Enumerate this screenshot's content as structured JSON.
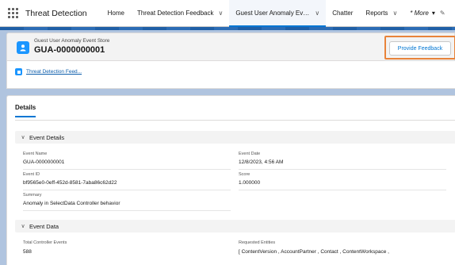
{
  "nav": {
    "app_name": "Threat Detection",
    "items": [
      {
        "label": "Home"
      },
      {
        "label": "Threat Detection Feedback",
        "chevron": "chevron-down-icon"
      },
      {
        "label": "Guest User Anomaly Event St...",
        "chevron": "chevron-down-icon",
        "active": true
      },
      {
        "label": "Chatter"
      },
      {
        "label": "Reports",
        "chevron": "chevron-down-icon"
      },
      {
        "label": "* More",
        "chevron": "caret-down-icon"
      }
    ],
    "accent_color": "#0176d3"
  },
  "record": {
    "object_type": "Guest User Anomaly Event Store",
    "name": "GUA-0000000001",
    "action_button": "Provide Feedback",
    "highlight_color": "#e8833a"
  },
  "related": {
    "link_label": "Threat Detection Feed..."
  },
  "tabs": {
    "details_label": "Details"
  },
  "sections": {
    "event_details": {
      "title": "Event Details",
      "fields": {
        "event_name_label": "Event Name",
        "event_name_value": "GUA-0000000001",
        "event_date_label": "Event Date",
        "event_date_value": "12/8/2023, 4:56 AM",
        "event_id_label": "Event ID",
        "event_id_value": "bf9565e0-0eff-452d-8581-7aba86c62d22",
        "score_label": "Score",
        "score_value": "1.000000",
        "summary_label": "Summary",
        "summary_value": "Anomaly in SelectData Controller behavior"
      }
    },
    "event_data": {
      "title": "Event Data",
      "fields": {
        "total_label": "Total Controller Events",
        "total_value": "588",
        "requested_label": "Requested Entities",
        "requested_value": "[ ContentVersion , AccountPartner , Contact , ContentWorkspace ,"
      }
    }
  }
}
